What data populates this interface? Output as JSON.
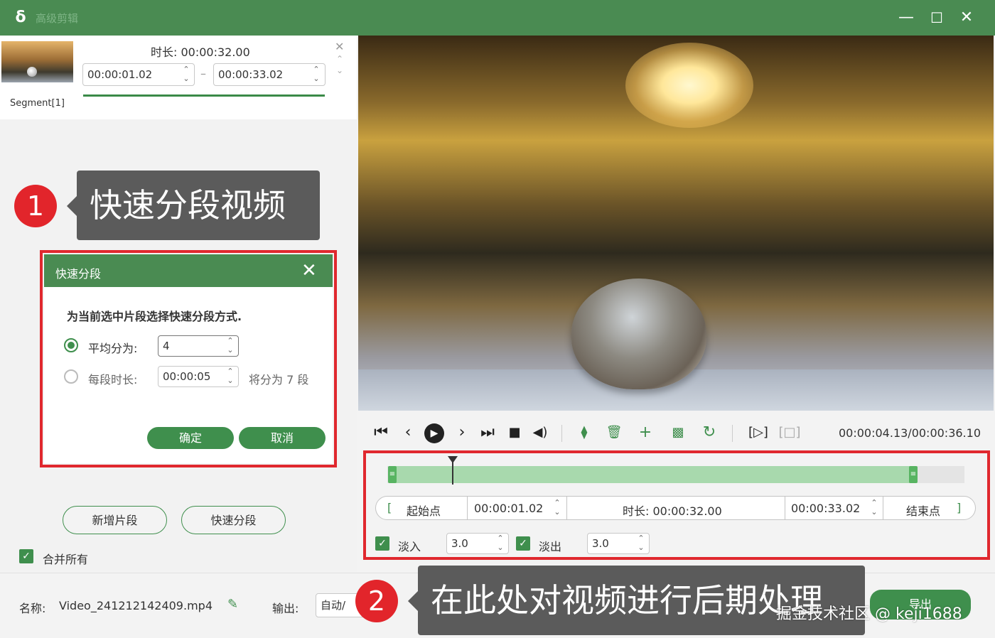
{
  "app": {
    "title": "高级剪辑",
    "logo_glyph": "ẟ",
    "accent": "#4a8b52",
    "callout_red": "#e2252b"
  },
  "window_controls": {
    "minimize": "—",
    "maximize": "☐",
    "close": "✕"
  },
  "segment": {
    "label": "Segment[1]",
    "duration_text": "时长: 00:00:32.00",
    "start": "00:00:01.02",
    "end": "00:00:33.02",
    "dash": "–"
  },
  "callouts": {
    "one": {
      "number": "1",
      "text": "快速分段视频"
    },
    "two": {
      "number": "2",
      "text": "在此处对视频进行后期处理"
    }
  },
  "quick_split_dialog": {
    "title": "快速分段",
    "description": "为当前选中片段选择快速分段方式.",
    "option_average_label": "平均分为:",
    "option_average_value": "4",
    "option_duration_label": "每段时长:",
    "option_duration_value": "00:00:05",
    "option_duration_hint": "将分为 7 段",
    "confirm_label": "确定",
    "cancel_label": "取消"
  },
  "left_actions": {
    "add_segment": "新增片段",
    "quick_split": "快速分段",
    "merge_all": "合并所有"
  },
  "player": {
    "timecode": "00:00:04.13/00:00:36.10",
    "icons": [
      "skip-start-icon",
      "step-back-icon",
      "play-icon",
      "step-forward-icon",
      "skip-end-icon",
      "stop-icon",
      "volume-icon",
      "split-icon",
      "delete-icon",
      "add-icon",
      "copy-icon",
      "rotate-icon",
      "bracket-play-icon",
      "crop-icon"
    ]
  },
  "timeline": {
    "start_label": "起始点",
    "start_bracket": "[",
    "start_value": "00:00:01.02",
    "duration_text": "时长: 00:00:32.00",
    "end_value": "00:00:33.02",
    "end_label": "结束点",
    "end_bracket": "]",
    "fade_in_label": "淡入",
    "fade_in_value": "3.0",
    "fade_out_label": "淡出",
    "fade_out_value": "3.0"
  },
  "bottom": {
    "name_label": "名称:",
    "file_name": "Video_241212142409.mp4",
    "output_label": "输出:",
    "output_value": "自动/",
    "export_label": "导出",
    "watermark": "掘金技术社区 @ keji1688"
  }
}
